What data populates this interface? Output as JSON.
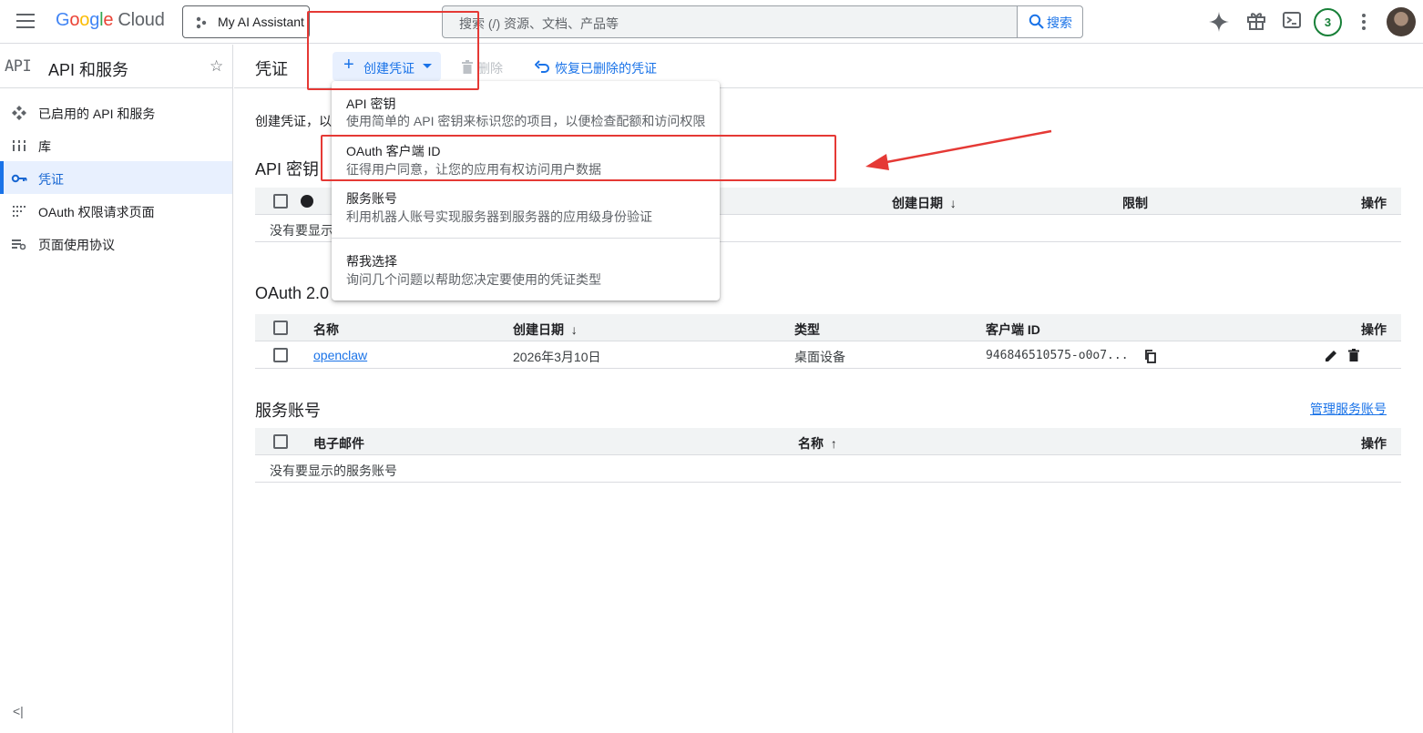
{
  "topbar": {
    "logo_letters": [
      "G",
      "o",
      "o",
      "g",
      "l",
      "e"
    ],
    "logo_cloud": "Cloud",
    "project_name": "My AI Assistant",
    "search_placeholder": "搜索 (/) 资源、文档、产品等",
    "search_button": "搜索",
    "notification_count": "3",
    "icons": [
      "menu-icon",
      "gemini-sparkle-icon",
      "gift-icon",
      "cloud-shell-icon",
      "more-vert-icon"
    ]
  },
  "sidebar": {
    "logo": "API",
    "title": "API 和服务",
    "items": [
      {
        "label": "已启用的 API 和服务",
        "icon": "enabled-apis-icon"
      },
      {
        "label": "库",
        "icon": "library-icon"
      },
      {
        "label": "凭证",
        "icon": "key-icon",
        "active": true
      },
      {
        "label": "OAuth 权限请求页面",
        "icon": "oauth-consent-icon"
      },
      {
        "label": "页面使用协议",
        "icon": "page-usage-icon"
      }
    ],
    "collapse_label": "<|"
  },
  "toolbar": {
    "page_title": "凭证",
    "create_label": "创建凭证",
    "delete_label": "删除",
    "restore_label": "恢复已删除的凭证"
  },
  "main": {
    "intro_text": "创建凭证，以",
    "api_keys": {
      "title": "API 密钥",
      "columns": [
        "创建日期",
        "限制",
        "操作"
      ],
      "empty_text": "没有要显示"
    },
    "oauth": {
      "title": "OAuth 2.0",
      "columns": [
        "名称",
        "创建日期",
        "类型",
        "客户端 ID",
        "操作"
      ],
      "rows": [
        {
          "name": "openclaw",
          "created": "2026年3月10日",
          "type": "桌面设备",
          "client_id": "946846510575-o0o7..."
        }
      ]
    },
    "service_accounts": {
      "title": "服务账号",
      "manage_link": "管理服务账号",
      "columns": [
        "电子邮件",
        "名称",
        "操作"
      ],
      "empty_text": "没有要显示的服务账号"
    }
  },
  "dropdown": {
    "items": [
      {
        "title": "API 密钥",
        "desc": "使用简单的 API 密钥来标识您的项目，以便检查配额和访问权限"
      },
      {
        "title": "OAuth 客户端 ID",
        "desc": "征得用户同意，让您的应用有权访问用户数据"
      },
      {
        "title": "服务账号",
        "desc": "利用机器人账号实现服务器到服务器的应用级身份验证"
      },
      {
        "title": "帮我选择",
        "desc": "询问几个问题以帮助您决定要使用的凭证类型"
      }
    ]
  },
  "colors": {
    "accent": "#1a73e8",
    "annotation": "#e53935",
    "active_bg": "#e8f0fe"
  }
}
